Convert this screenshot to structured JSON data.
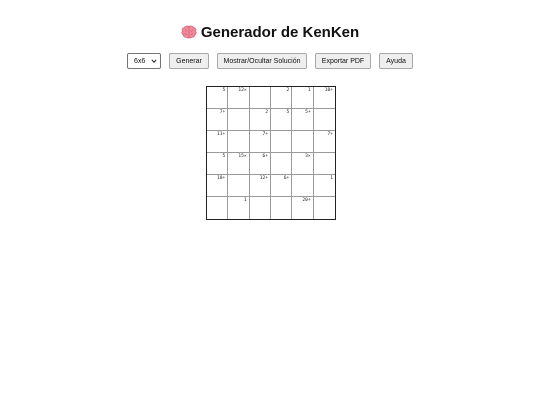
{
  "header": {
    "title": "Generador de KenKen",
    "icon": "brain-icon"
  },
  "toolbar": {
    "size_select_value": "6x6",
    "generate_label": "Generar",
    "toggle_solution_label": "Mostrar/Ocultar Solución",
    "export_pdf_label": "Exportar PDF",
    "help_label": "Ayuda"
  },
  "puzzle": {
    "size": 6,
    "rows": [
      [
        "5",
        "12×",
        "",
        "2",
        "1",
        "10+"
      ],
      [
        "7+",
        "",
        "2",
        "5",
        "5+",
        ""
      ],
      [
        "11+",
        "",
        "7+",
        "",
        "",
        "7+"
      ],
      [
        "5",
        "15×",
        "6+",
        "",
        "3×",
        ""
      ],
      [
        "18+",
        "",
        "12+",
        "6+",
        "",
        "1"
      ],
      [
        "",
        "1",
        "",
        "",
        "20+",
        ""
      ]
    ]
  },
  "colors": {
    "brain": "#f08a9a",
    "button_bg": "#efefef",
    "grid_border": "#222222"
  }
}
